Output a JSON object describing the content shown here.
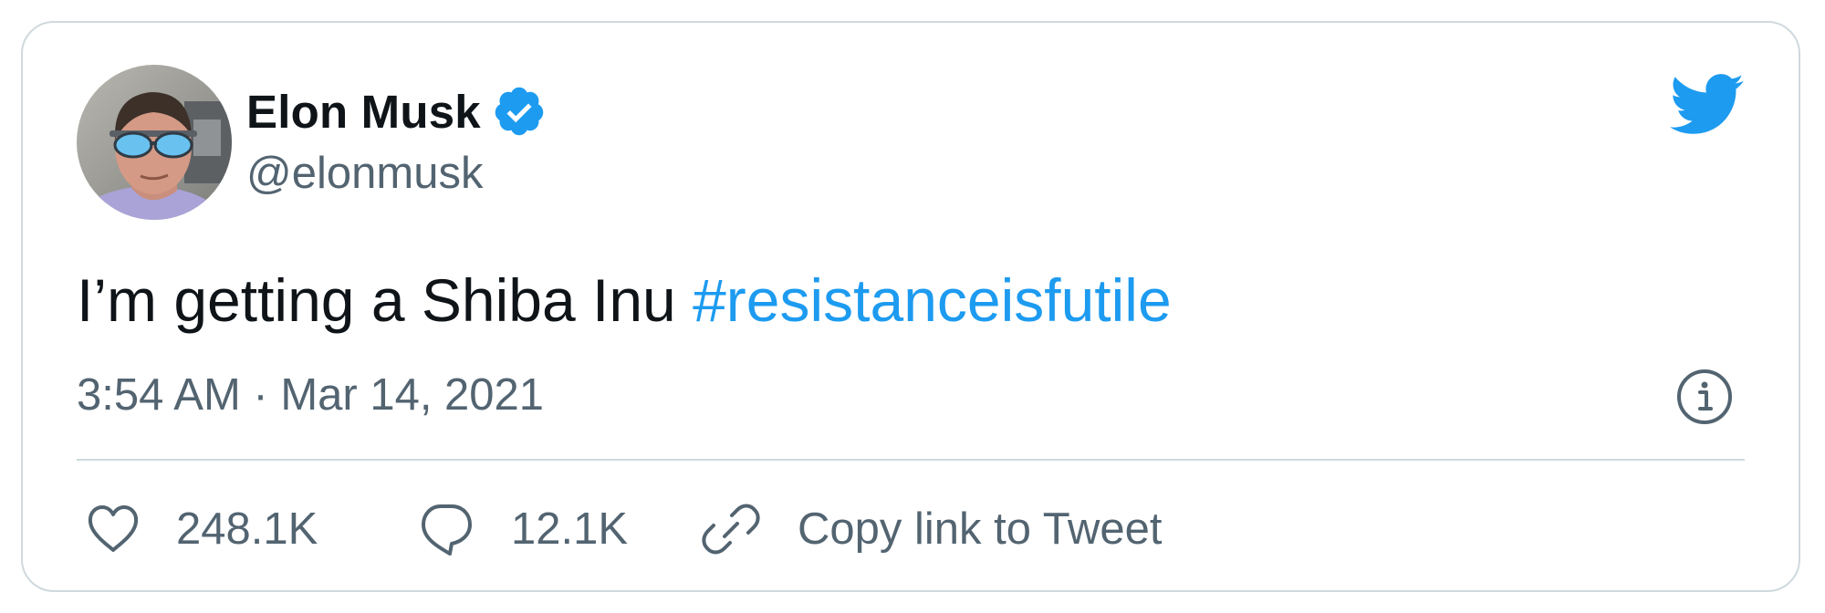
{
  "user": {
    "display_name": "Elon Musk",
    "handle": "@elonmusk",
    "verified_icon": "verified-badge-icon"
  },
  "tweet": {
    "text": "I’m getting a Shiba Inu",
    "hashtag": "#resistanceisfutile",
    "timestamp": "3:54 AM · Mar 14, 2021"
  },
  "actions": {
    "like": {
      "icon": "heart-icon",
      "count": "248.1K"
    },
    "reply": {
      "icon": "reply-bubble-icon",
      "count": "12.1K"
    },
    "copy_link": {
      "icon": "link-icon",
      "label": "Copy link to Tweet"
    }
  },
  "icons": {
    "brand": "twitter-bird-icon",
    "info": "info-icon"
  },
  "colors": {
    "accent": "#1d9bf0",
    "text_primary": "#0f1419",
    "text_secondary": "#536471",
    "border": "#cfd9de"
  }
}
